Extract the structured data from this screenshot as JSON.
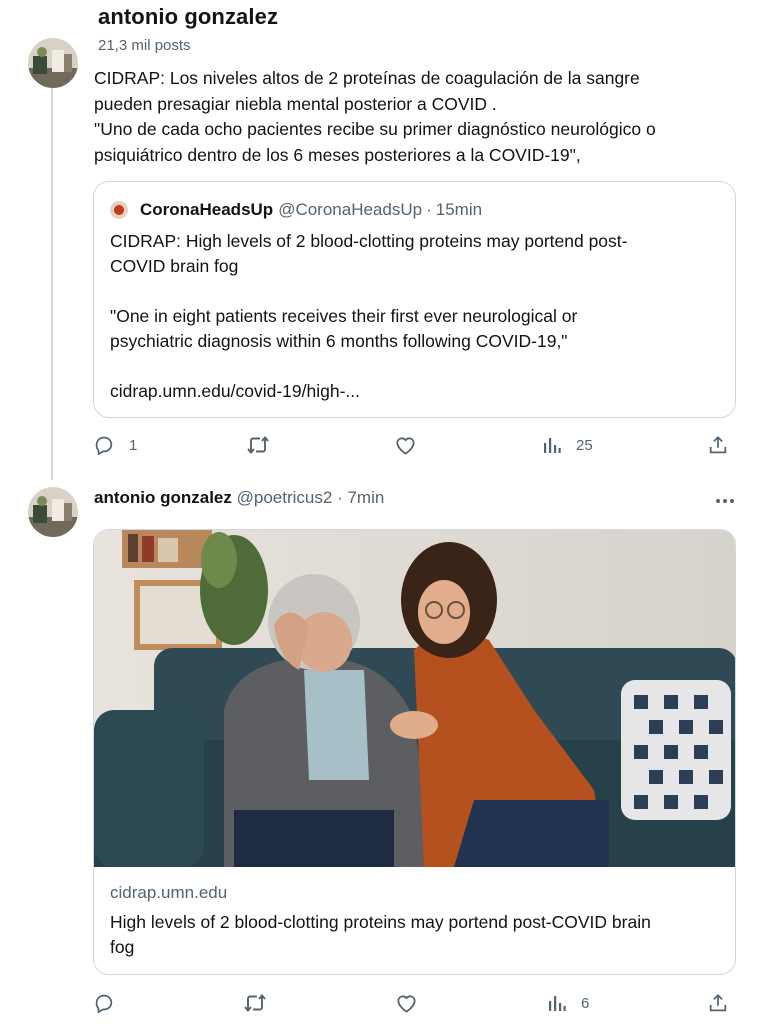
{
  "header": {
    "name": "antonio gonzalez",
    "post_count": "21,3 mil posts"
  },
  "tweet1": {
    "text_lines": [
      "CIDRAP: Los niveles altos de 2 proteínas de coagulación de la sangre",
      "pueden presagiar niebla mental posterior a COVID .",
      "\"Uno de cada ocho pacientes recibe su primer diagnóstico neurológico o",
      "psiquiátrico dentro de los 6 meses posteriores a la COVID-19\","
    ],
    "quote": {
      "name": "CoronaHeadsUp",
      "handle": "@CoronaHeadsUp",
      "separator": "·",
      "time": "15min",
      "body_lines": [
        "CIDRAP: High levels of 2 blood-clotting proteins may portend post-",
        "COVID brain fog",
        "",
        "\"One in eight patients receives their first ever neurological or",
        "psychiatric diagnosis within 6 months following COVID-19,\"",
        "",
        "cidrap.umn.edu/covid-19/high-..."
      ]
    },
    "actions": {
      "replies": "1",
      "reposts": "",
      "likes": "",
      "views": "25"
    }
  },
  "tweet2": {
    "name": "antonio gonzalez",
    "handle": "@poetricus2",
    "separator": "·",
    "time": "7min",
    "card": {
      "domain": "cidrap.umn.edu",
      "title_lines": [
        "High levels of 2 blood-clotting proteins may portend post-COVID brain",
        "fog"
      ]
    },
    "actions": {
      "replies": "",
      "reposts": "",
      "likes": "",
      "views": "6"
    }
  },
  "icons": [
    "reply-icon",
    "repost-icon",
    "like-icon",
    "views-icon",
    "share-icon",
    "more-icon"
  ],
  "colors": {
    "text": "#0f1419",
    "muted": "#536471",
    "border": "#cfd9de",
    "thread_line": "#cfd9de"
  }
}
